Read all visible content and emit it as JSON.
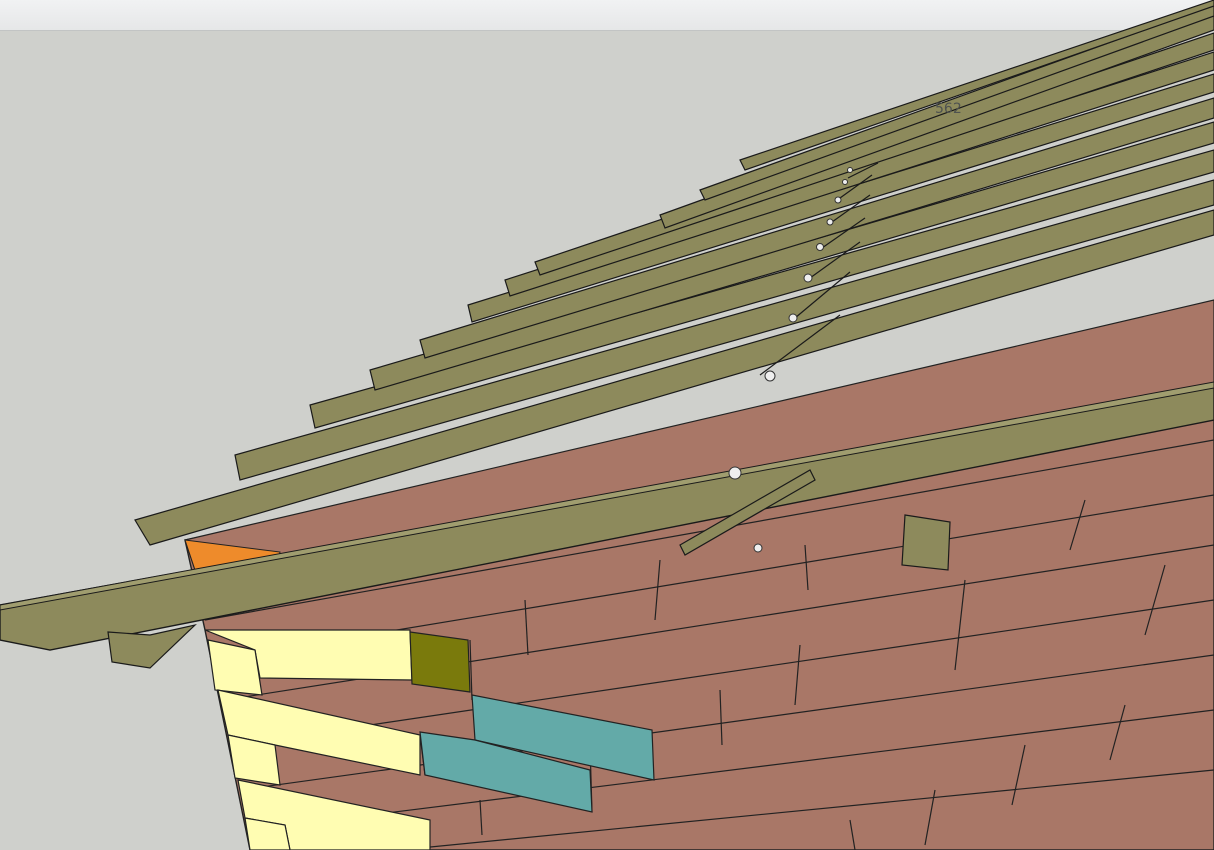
{
  "app": {
    "toolbar": {
      "visible": true
    },
    "viewport": {
      "dimension_label": "562",
      "colors": {
        "background": "#cfd0cc",
        "wall_panel": "#a97767",
        "rafter": "#8d8a5c",
        "rafter_dark": "#6d6a43",
        "rafter_light": "#a09d6f",
        "panel_yellow": "#fffdb2",
        "panel_olive": "#7a7a0c",
        "panel_teal": "#63aaa8",
        "panel_orange": "#ee8b2b",
        "edge_line": "#1a1a1a"
      }
    }
  }
}
